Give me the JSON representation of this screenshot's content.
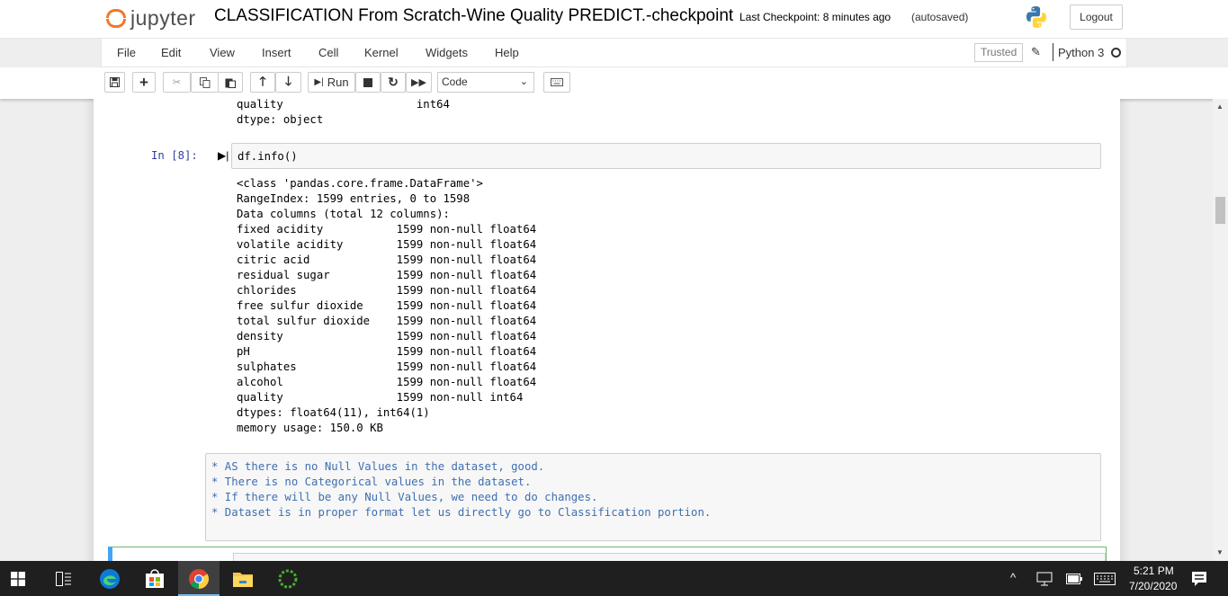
{
  "header": {
    "logo_text": "jupyter",
    "notebook_title": "CLASSIFICATION From Scratch-Wine Quality PREDICT.-checkpoint",
    "checkpoint": "Last Checkpoint: 8 minutes ago",
    "autosave": "(autosaved)",
    "logout_label": "Logout"
  },
  "menubar": {
    "items": [
      "File",
      "Edit",
      "View",
      "Insert",
      "Cell",
      "Kernel",
      "Widgets",
      "Help"
    ],
    "trusted_label": "Trusted",
    "kernel_name": "Python 3"
  },
  "toolbar": {
    "run_label": "Run",
    "cell_type": "Code"
  },
  "notebook": {
    "prev_output": "quality                    int64\ndtype: object",
    "cell8": {
      "prompt": "In [8]:",
      "code": "df.info()",
      "output": "<class 'pandas.core.frame.DataFrame'>\nRangeIndex: 1599 entries, 0 to 1598\nData columns (total 12 columns):\nfixed acidity           1599 non-null float64\nvolatile acidity        1599 non-null float64\ncitric acid             1599 non-null float64\nresidual sugar          1599 non-null float64\nchlorides               1599 non-null float64\nfree sulfur dioxide     1599 non-null float64\ntotal sulfur dioxide    1599 non-null float64\ndensity                 1599 non-null float64\npH                      1599 non-null float64\nsulphates               1599 non-null float64\nalcohol                 1599 non-null float64\nquality                 1599 non-null int64\ndtypes: float64(11), int64(1)\nmemory usage: 150.0 KB"
    },
    "markdown": "* AS there is no Null Values in the dataset, good.\n* There is no Categorical values in the dataset.\n* If there will be any Null Values, we need to do changes.\n* Dataset is in proper format let us directly go to Classification portion."
  },
  "taskbar": {
    "time": "5:21 PM",
    "date": "7/20/2020"
  },
  "colors": {
    "jupyter_orange": "#f37726",
    "prompt_blue": "#303F9F",
    "markdown_text": "#3f6fb0",
    "selected_cell_border": "#66bb6a",
    "taskbar": "#1f1f1f"
  }
}
